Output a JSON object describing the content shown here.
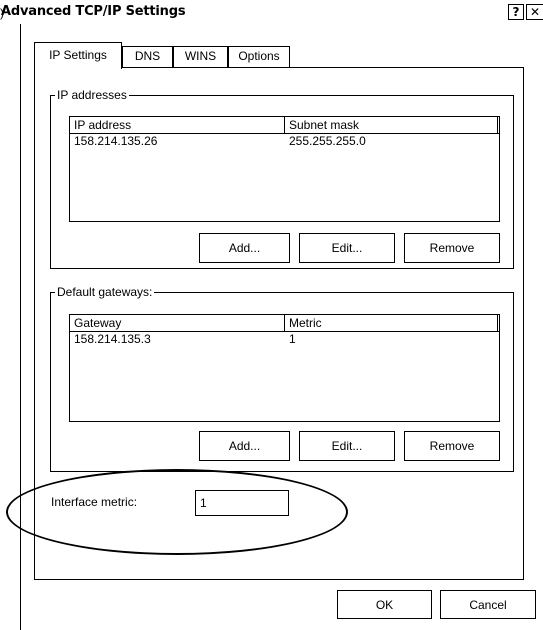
{
  "window": {
    "title": "Advanced TCP/IP Settings",
    "help_glyph": "?",
    "close_glyph": "✕"
  },
  "tabs": [
    {
      "label": "IP Settings",
      "active": true
    },
    {
      "label": "DNS",
      "active": false
    },
    {
      "label": "WINS",
      "active": false
    },
    {
      "label": "Options",
      "active": false
    }
  ],
  "ip_addresses": {
    "legend": "IP addresses",
    "columns": [
      "IP address",
      "Subnet mask"
    ],
    "rows": [
      [
        "158.214.135.26",
        "255.255.255.0"
      ]
    ],
    "add_label": "Add...",
    "edit_label": "Edit...",
    "remove_label": "Remove"
  },
  "gateways": {
    "legend": "Default gateways:",
    "columns": [
      "Gateway",
      "Metric"
    ],
    "rows": [
      [
        "158.214.135.3",
        "1"
      ]
    ],
    "add_label": "Add...",
    "edit_label": "Edit...",
    "remove_label": "Remove"
  },
  "interface_metric": {
    "label": "Interface metric:",
    "value": "1"
  },
  "footer": {
    "ok_label": "OK",
    "cancel_label": "Cancel"
  },
  "annotation": {
    "paren": ")"
  }
}
